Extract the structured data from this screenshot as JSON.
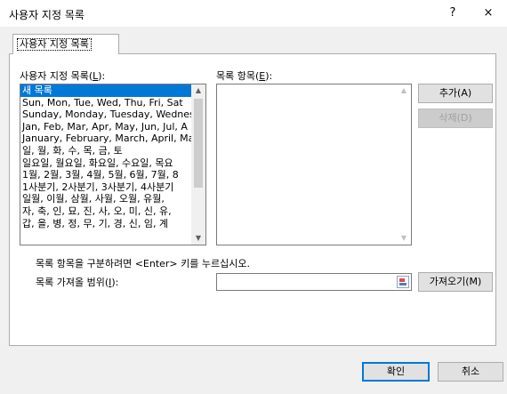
{
  "window": {
    "title": "사용자 지정 목록",
    "help_label": "?",
    "close_label": "×"
  },
  "tab": {
    "label": "사용자 지정 목록"
  },
  "custom_lists": {
    "label_text": "사용자 지정 목록(",
    "label_key": "L",
    "label_suffix": "):",
    "items": [
      "새 목록",
      "Sun, Mon, Tue, Wed, Thu, Fri, Sat",
      "Sunday, Monday, Tuesday, Wednes",
      "Jan, Feb, Mar, Apr, May, Jun, Jul, A",
      "January, February, March, April, Ma",
      "일, 월, 화, 수, 목, 금, 토",
      "일요일, 월요일, 화요일, 수요일, 목요",
      "1월, 2월, 3월, 4월, 5월, 6월, 7월, 8",
      "1사분기, 2사분기, 3사분기, 4사분기",
      "일월, 이월, 삼월, 사월, 오월, 유월, ",
      "자, 축, 인, 묘, 진, 사, 오, 미, 신, 유,",
      "갑, 을, 병, 정, 무, 기, 경, 신, 임, 계"
    ],
    "selected_index": 0
  },
  "list_entries": {
    "label_text": "목록 항목(",
    "label_key": "E",
    "label_suffix": "):"
  },
  "buttons": {
    "add": "추가(A)",
    "delete": "삭제(D)",
    "import": "가져오기(M)",
    "ok": "확인",
    "cancel": "취소"
  },
  "hint": "목록 항목을 구분하려면 <Enter> 키를 누르십시오.",
  "import_range": {
    "label_text": "목록 가져올 범위(",
    "label_key": "I",
    "label_suffix": "):",
    "value": ""
  }
}
